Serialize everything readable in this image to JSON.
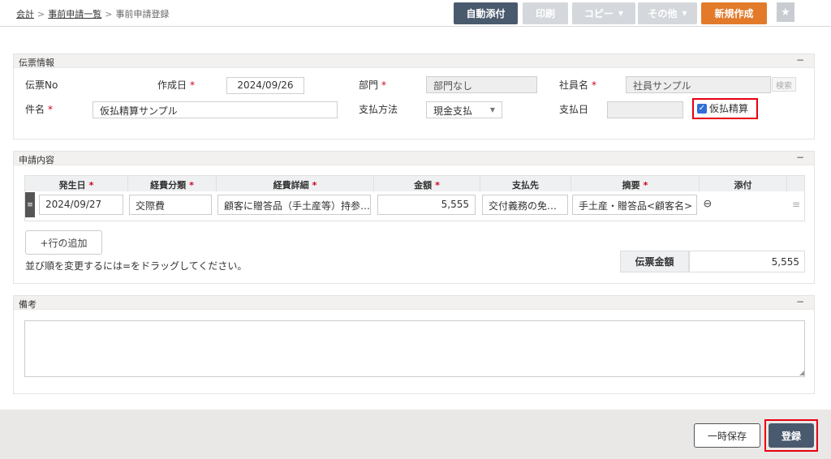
{
  "breadcrumb": {
    "item1": "会計",
    "item2": "事前申請一覧",
    "current": "事前申請登録",
    "sep": ">"
  },
  "toolbar": {
    "auto_attach": "自動添付",
    "print": "印刷",
    "copy": "コピー",
    "other": "その他",
    "new": "新規作成",
    "star_icon": "star-icon"
  },
  "header_panel": {
    "title": "伝票情報",
    "collapse": "−",
    "slip_no_label": "伝票No",
    "created_label": "作成日",
    "created_value": "2024/09/26",
    "dept_label": "部門",
    "dept_value": "部門なし",
    "employee_label": "社員名",
    "employee_value": "社員サンプル",
    "search_label": "検索",
    "subject_label": "件名",
    "subject_value": "仮払精算サンプル",
    "payment_method_label": "支払方法",
    "payment_method_value": "現金支払",
    "payment_date_label": "支払日",
    "payment_date_value": "",
    "advance_label": "仮払精算",
    "advance_checked": true,
    "required_mark": "*"
  },
  "detail_panel": {
    "title": "申請内容",
    "collapse": "−",
    "columns": [
      "発生日",
      "経費分類",
      "経費詳細",
      "金額",
      "支払先",
      "摘要",
      "添付"
    ],
    "required_columns": [
      true,
      true,
      true,
      true,
      false,
      true,
      false
    ],
    "rows": [
      {
        "date": "2024/09/27",
        "category": "交際費",
        "detail": "顧客に贈答品（手土産等）持参…",
        "amount": "5,555",
        "payee": "交付義務の免…",
        "memo": "手土産・贈答品<顧客名>",
        "attach_icon": "paperclip-icon"
      }
    ],
    "add_row_label": "+行の追加",
    "reorder_note": "並び順を変更するには=をドラッグしてください。",
    "total_label": "伝票金額",
    "total_value": "5,555"
  },
  "remarks_panel": {
    "title": "備考",
    "collapse": "−",
    "value": ""
  },
  "footer": {
    "save_temp_label": "一時保存",
    "register_label": "登録"
  },
  "colors": {
    "primary": "#4a5a6e",
    "accent": "#e27a2a",
    "highlight": "#e60012",
    "disabled": "#d4d7db"
  }
}
